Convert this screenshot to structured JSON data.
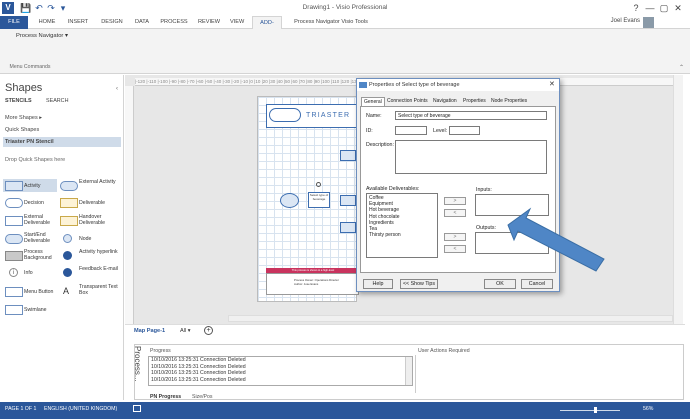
{
  "window": {
    "title": "Drawing1 - Visio Professional",
    "user": "Joel Evans",
    "help": "?",
    "min": "—",
    "max": "▢",
    "close": "✕"
  },
  "quick_access": {
    "save": "💾",
    "undo": "↶",
    "redo": "↷",
    "more": "▾"
  },
  "ribbon": {
    "tabs": [
      "FILE",
      "HOME",
      "INSERT",
      "DESIGN",
      "DATA",
      "PROCESS",
      "REVIEW",
      "VIEW",
      "ADD-INS",
      "Process Navigator Visio Tools"
    ],
    "active_tab": "ADD-INS",
    "menu_button": "Process Navigator ▾",
    "group_label": "Menu Commands"
  },
  "shapes_pane": {
    "title": "Shapes",
    "tabs": [
      "STENCILS",
      "SEARCH"
    ],
    "more_shapes": "More Shapes",
    "quick_shapes": "Quick Shapes",
    "stencil": "Triaster PN Stencil",
    "drop_hint": "Drop Quick Shapes here",
    "shapes": [
      [
        "Activity",
        "External Activity"
      ],
      [
        "Decision",
        "Deliverable"
      ],
      [
        "External Deliverable",
        "Handover Deliverable"
      ],
      [
        "Start/End Deliverable",
        "Node"
      ],
      [
        "Process Background",
        "Activity hyperlink"
      ],
      [
        "Info",
        "Feedback E-mail"
      ],
      [
        "Menu Button",
        "Transparent Text Box"
      ],
      [
        "Swimlane",
        ""
      ]
    ]
  },
  "ruler": {
    "marks": "|-120  |-110  |-100  |-90  |-80  |-70  |-60  |-50  |-40  |-30  |-20  |-10  |0  |10  |20  |30  |40  |50  |60  |70  |80  |90  |100  |110  |120  |130  |140  |150  |160  |170  |180  |190  |200  |210  |220  |230  |240  |250  |260  |270  |280  |290"
  },
  "page": {
    "logo": "TRIASTER",
    "band_text": "This process is shown to a high-level",
    "footer_line1": "Process Owner: Operations Director",
    "footer_line2": "Author: Jose Evans",
    "nodes": [
      "Select type of beverage"
    ]
  },
  "page_tabs": {
    "current": "Map Page-1",
    "all": "All ▾",
    "add": "+"
  },
  "progress": {
    "side_label": "Process...",
    "header": "Progress",
    "actions_header": "User Actions Required",
    "log": [
      "10/10/2016 13:25:31 Connection Deleted",
      "10/10/2016 13:25:31 Connection Deleted",
      "10/10/2016 13:25:31 Connection Deleted",
      "10/10/2016 13:25:31 Connection Deleted"
    ],
    "tabs": [
      "PN Progress",
      "Size/Pos"
    ]
  },
  "status_bar": {
    "page": "PAGE 1 OF 1",
    "language": "ENGLISH (UNITED KINGDOM)",
    "zoom": "56%"
  },
  "dialog": {
    "title": "Properties of Select type of beverage",
    "tabs": [
      "General",
      "Connection Points",
      "Navigation",
      "Properties",
      "Node Properties"
    ],
    "active_tab": "General",
    "name_label": "Name:",
    "name_value": "Select type of beverage",
    "id_label": "ID:",
    "id_value": "",
    "level_label": "Level:",
    "level_value": "",
    "description_label": "Description:",
    "available_label": "Available Deliverables:",
    "available": [
      "Coffee",
      "Equipment",
      "Hot beverage",
      "Hot chocolate",
      "Ingredients",
      "Tea",
      "Thirsty person"
    ],
    "inputs_label": "Inputs:",
    "outputs_label": "Outputs:",
    "move_right": ">",
    "move_left": "<",
    "help": "Help",
    "show_tips": "<< Show Tips",
    "ok": "OK",
    "cancel": "Cancel"
  },
  "colors": {
    "accent": "#2b579a",
    "arrow": "#4f86c6",
    "band": "#c9335e"
  }
}
